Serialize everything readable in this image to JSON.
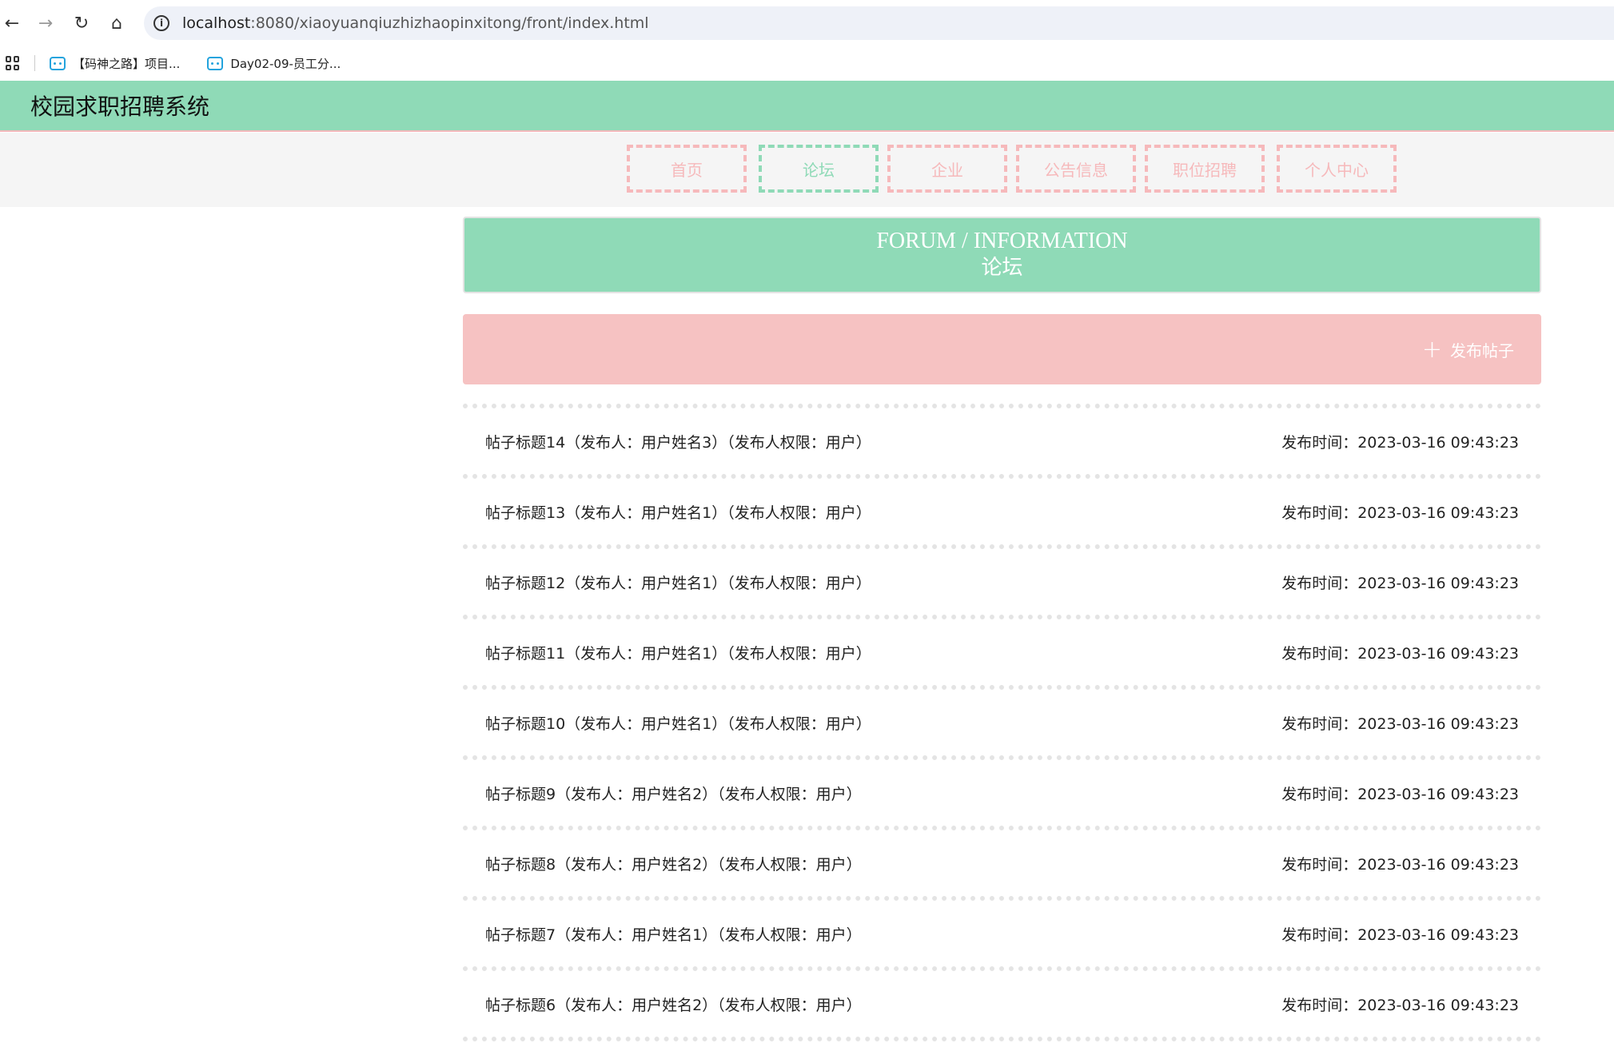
{
  "browser": {
    "url_host": "localhost",
    "url_rest": ":8080/xiaoyuanqiuzhizhaopinxitong/front/index.html",
    "bookmarks": [
      {
        "label": "【码神之路】项目...",
        "icon": "bilibili-tv-icon"
      },
      {
        "label": "Day02-09-员工分...",
        "icon": "bilibili-tv-icon"
      }
    ]
  },
  "site": {
    "title": "校园求职招聘系统"
  },
  "nav": {
    "items": [
      {
        "label": "首页",
        "active": false
      },
      {
        "label": "论坛",
        "active": true
      },
      {
        "label": "企业",
        "active": false
      },
      {
        "label": "公告信息",
        "active": false
      },
      {
        "label": "职位招聘",
        "active": false
      },
      {
        "label": "个人中心",
        "active": false
      }
    ]
  },
  "banner": {
    "title_en": "FORUM / INFORMATION",
    "title_cn": "论坛"
  },
  "actions": {
    "add_post_label": "发布帖子"
  },
  "posts": [
    {
      "title": "帖子标题14（发布人：用户姓名3）（发布人权限：用户）",
      "time": "发布时间：2023-03-16 09:43:23"
    },
    {
      "title": "帖子标题13（发布人：用户姓名1）（发布人权限：用户）",
      "time": "发布时间：2023-03-16 09:43:23"
    },
    {
      "title": "帖子标题12（发布人：用户姓名1）（发布人权限：用户）",
      "time": "发布时间：2023-03-16 09:43:23"
    },
    {
      "title": "帖子标题11（发布人：用户姓名1）（发布人权限：用户）",
      "time": "发布时间：2023-03-16 09:43:23"
    },
    {
      "title": "帖子标题10（发布人：用户姓名1）（发布人权限：用户）",
      "time": "发布时间：2023-03-16 09:43:23"
    },
    {
      "title": "帖子标题9（发布人：用户姓名2）（发布人权限：用户）",
      "time": "发布时间：2023-03-16 09:43:23"
    },
    {
      "title": "帖子标题8（发布人：用户姓名2）（发布人权限：用户）",
      "time": "发布时间：2023-03-16 09:43:23"
    },
    {
      "title": "帖子标题7（发布人：用户姓名1）（发布人权限：用户）",
      "time": "发布时间：2023-03-16 09:43:23"
    },
    {
      "title": "帖子标题6（发布人：用户姓名2）（发布人权限：用户）",
      "time": "发布时间：2023-03-16 09:43:23"
    }
  ],
  "colors": {
    "mint": "#8fdab7",
    "pink": "#f6c2c2",
    "pink_border": "#f6b9bb"
  }
}
